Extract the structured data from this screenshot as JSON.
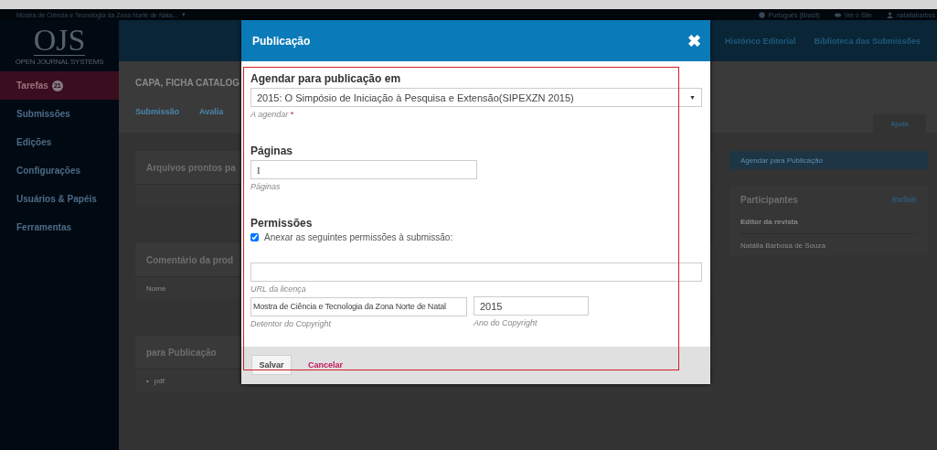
{
  "top_bar": {
    "site_title": "Mostra de Ciência e Tecnologia da Zona Norte de Nata...",
    "site_caret": "▾",
    "links": [
      {
        "kind": "language",
        "label": "Português (Brasil)"
      },
      {
        "kind": "view",
        "label": "Ver o Site"
      },
      {
        "kind": "user",
        "label": "nataliabarbos"
      }
    ]
  },
  "logo": {
    "text": "OJS",
    "subtitle": "OPEN JOURNAL SYSTEMS"
  },
  "header_nav": [
    {
      "label": "Histórico Editorial"
    },
    {
      "label": "Biblioteca das Submissões"
    }
  ],
  "sidebar": {
    "items": [
      {
        "label": "Tarefas",
        "badge": "21",
        "selected": true
      },
      {
        "label": "Submissões",
        "selected": false
      },
      {
        "label": "Edições",
        "selected": false
      },
      {
        "label": "Configurações",
        "selected": false
      },
      {
        "label": "Usuários & Papéis",
        "selected": false
      },
      {
        "label": "Ferramentas",
        "selected": false
      }
    ]
  },
  "submission": {
    "title": "CAPA, FICHA CATALOG",
    "tabs": [
      {
        "label": "Submissão",
        "selected": false
      },
      {
        "label": "Avalia",
        "selected": false
      }
    ],
    "help": "Ajuda",
    "panels": [
      {
        "title": "Arquivos prontos pa"
      },
      {
        "title": "Comentário da prod",
        "column": "Nome"
      },
      {
        "title": "para Publicação",
        "bullet": "•",
        "file": "pdf"
      }
    ],
    "schedule_button": "Agendar para Publicação",
    "participants": {
      "title": "Participantes",
      "add": "Incluir",
      "group": "Editor da revista",
      "member": "Natália Barbosa de Souza"
    }
  },
  "modal": {
    "title": "Publicação",
    "close": "✖",
    "schedule": {
      "label": "Agendar para publicação em",
      "value": "2015: O Simpósio de Iniciação à Pesquisa e Extensão(SIPEXZN 2015)",
      "hint": "A agendar",
      "required": "*",
      "caret": "▼"
    },
    "pages": {
      "label": "Páginas",
      "value": "I",
      "hint": "Páginas"
    },
    "permissions": {
      "label": "Permissões",
      "attach_label": "Anexar as seguintes permissões à submissão:",
      "checked": true,
      "license_hint": "URL da licença",
      "holder_value": "Mostra de Ciência e Tecnologia da Zona Norte de Natal",
      "holder_hint": "Detentor do Copyright",
      "year_value": "2015",
      "year_hint": "Ano do Copyright"
    },
    "buttons": {
      "save": "Salvar",
      "cancel": "Cancelar"
    }
  }
}
